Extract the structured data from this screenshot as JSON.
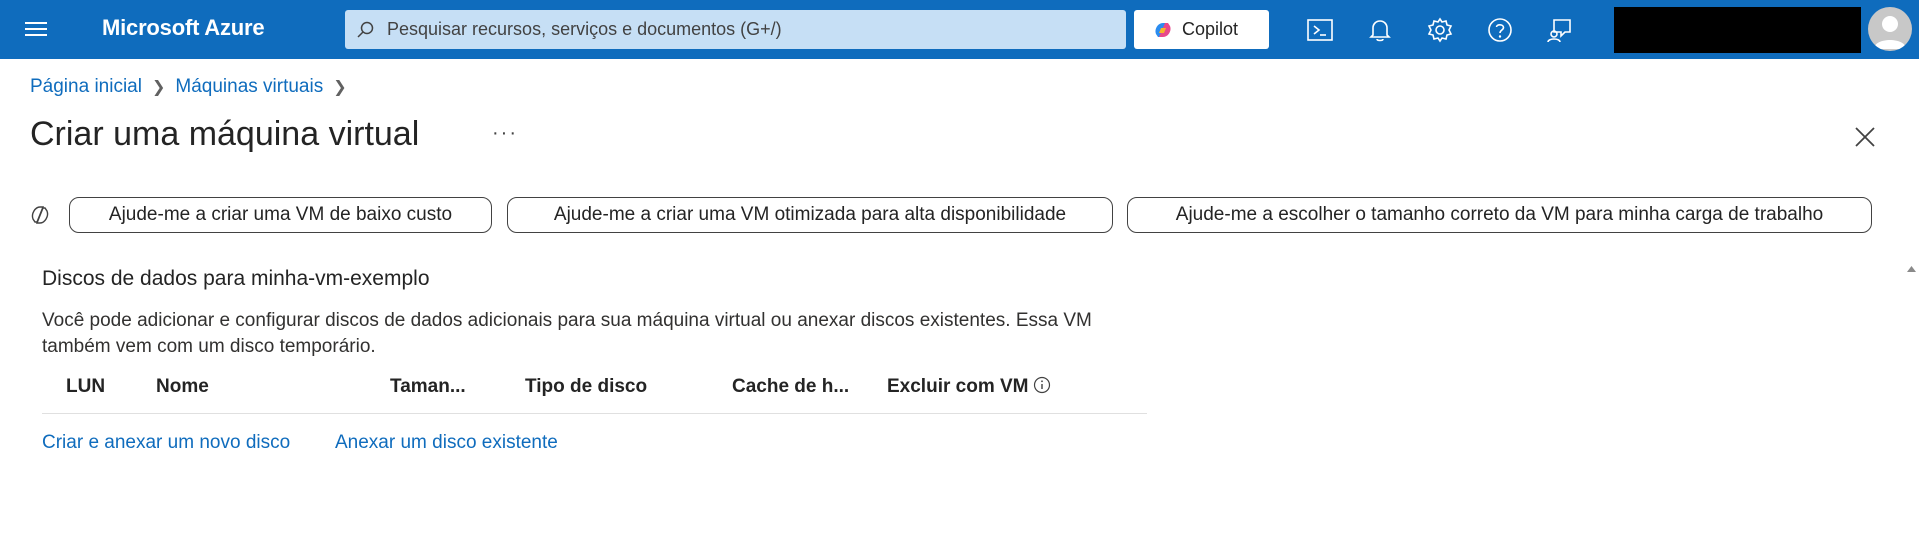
{
  "topbar": {
    "brand": "Microsoft Azure",
    "search_placeholder": "Pesquisar recursos, serviços e documentos (G+/)",
    "copilot_label": "Copilot",
    "color": "#0f6cbd"
  },
  "breadcrumb": {
    "items": [
      "Página inicial",
      "Máquinas virtuais"
    ]
  },
  "page": {
    "title": "Criar uma máquina virtual",
    "more": "···"
  },
  "suggestions": [
    "Ajude-me a criar uma VM de baixo custo",
    "Ajude-me a criar uma VM otimizada para alta disponibilidade",
    "Ajude-me a escolher o tamanho correto da VM para minha carga de trabalho"
  ],
  "disks": {
    "section_title": "Discos de dados para minha-vm-exemplo",
    "description": "Você pode adicionar e configurar discos de dados adicionais para sua máquina virtual ou anexar discos existentes. Essa VM também vem com um disco temporário.",
    "columns": [
      "LUN",
      "Nome",
      "Taman...",
      "Tipo de disco",
      "Cache de h...",
      "Excluir com VM"
    ],
    "create_link": "Criar e anexar um novo disco",
    "attach_link": "Anexar um disco existente"
  }
}
